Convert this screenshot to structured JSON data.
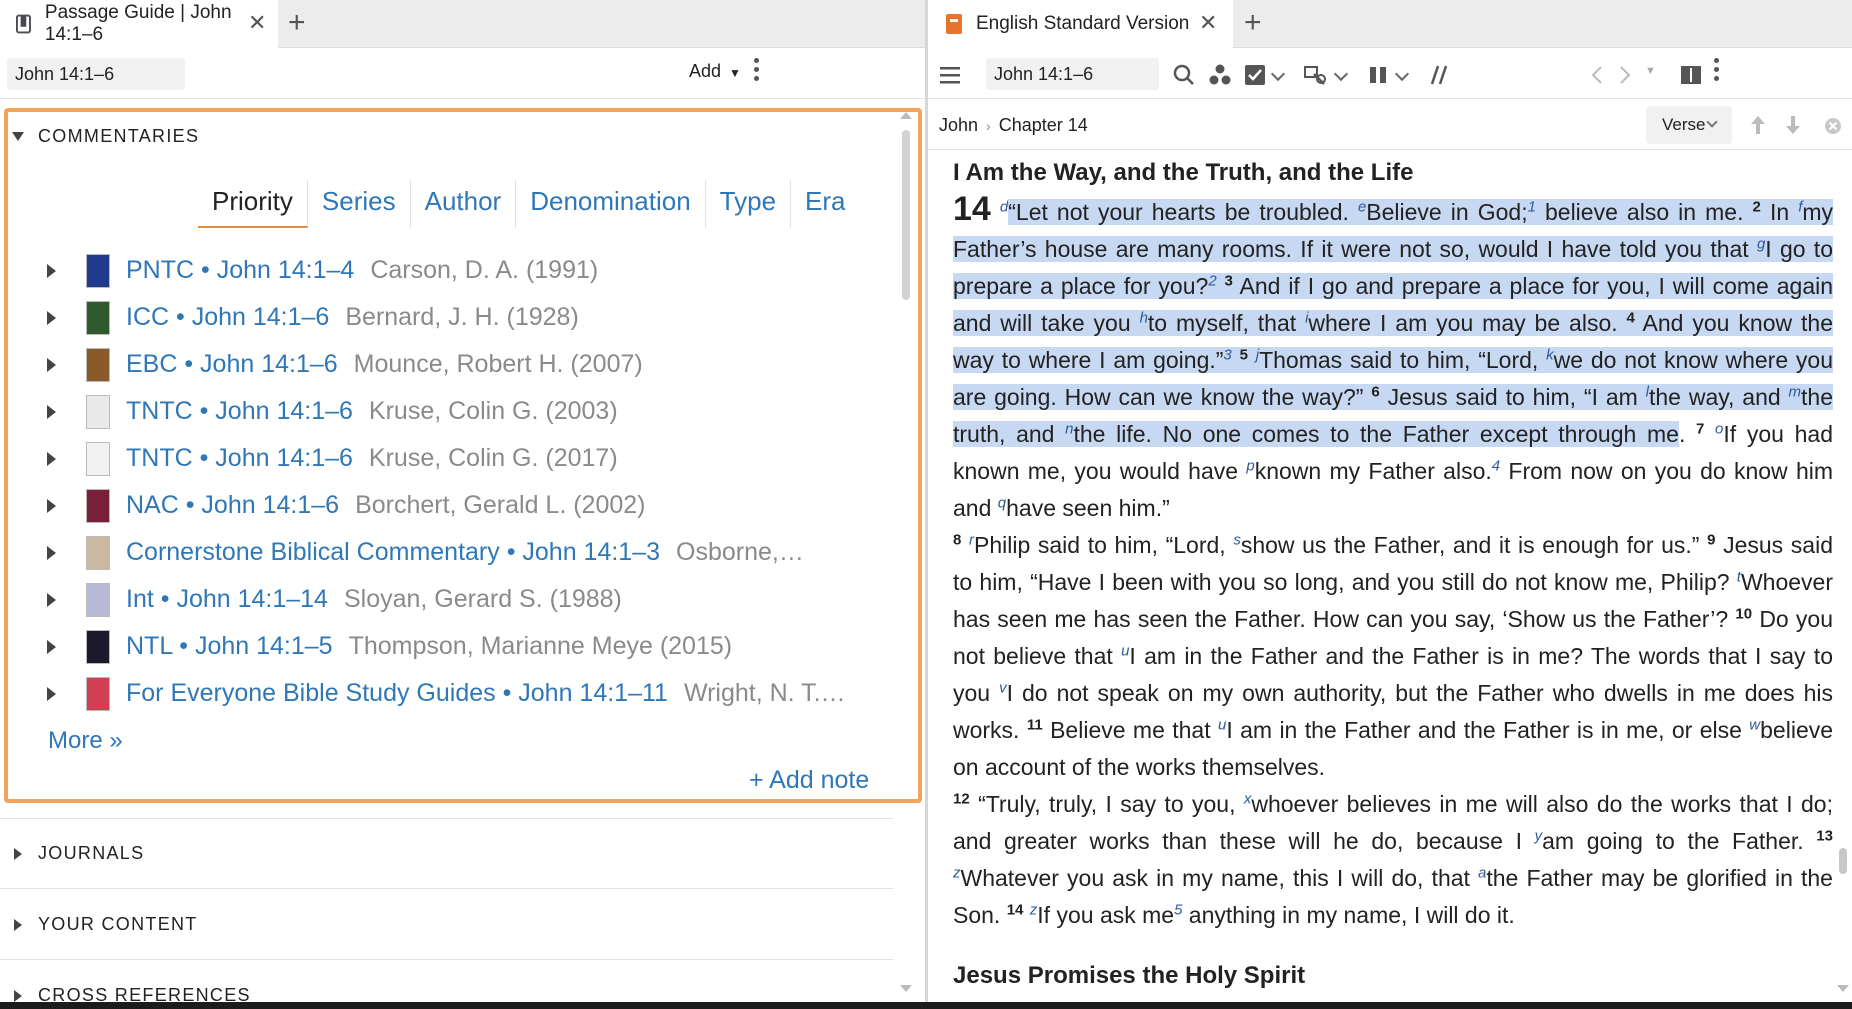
{
  "left": {
    "tab_title": "Passage Guide | John 14:1–6",
    "reference": "John 14:1–6",
    "add_label": "Add",
    "commentaries": {
      "heading": "COMMENTARIES",
      "sort_tabs": [
        "Priority",
        "Series",
        "Author",
        "Denomination",
        "Type",
        "Era"
      ],
      "items": [
        {
          "title": "PNTC • John 14:1–4",
          "author": "Carson, D. A. (1991)",
          "cover": "#1f3a8a"
        },
        {
          "title": "ICC • John 14:1–6",
          "author": "Bernard, J. H. (1928)",
          "cover": "#2f5a2b"
        },
        {
          "title": "EBC • John 14:1–6",
          "author": "Mounce, Robert H. (2007)",
          "cover": "#8a5a2b"
        },
        {
          "title": "TNTC • John 14:1–6",
          "author": "Kruse, Colin G. (2003)",
          "cover": "#e9e9e9"
        },
        {
          "title": "TNTC • John 14:1–6",
          "author": "Kruse, Colin G. (2017)",
          "cover": "#f2f2f2"
        },
        {
          "title": "NAC • John 14:1–6",
          "author": "Borchert, Gerald L. (2002)",
          "cover": "#7a1f3a"
        },
        {
          "title": "Cornerstone Biblical Commentary • John 14:1–3",
          "author": "Osborne,…",
          "cover": "#c9b9a0"
        },
        {
          "title": "Int • John 14:1–14",
          "author": "Sloyan, Gerard S. (1988)",
          "cover": "#b8b8d8"
        },
        {
          "title": "NTL • John 14:1–5",
          "author": "Thompson, Marianne Meye (2015)",
          "cover": "#1a1a2a"
        },
        {
          "title": "For Everyone Bible Study Guides • John 14:1–11",
          "author": "Wright, N. T.…",
          "cover": "#d04050"
        }
      ],
      "more_label": "More »",
      "add_note_label": "+ Add note"
    },
    "sections": [
      "JOURNALS",
      "YOUR CONTENT",
      "CROSS REFERENCES"
    ]
  },
  "right": {
    "tab_title": "English Standard Version",
    "reference": "John 14:1–6",
    "breadcrumb": [
      "John",
      "Chapter 14"
    ],
    "verse_label": "Verse",
    "pericope_1": "I Am the Way, and the Truth, and the Life",
    "chapter_number": "14",
    "pericope_2": "Jesus Promises the Holy Spirit",
    "text": {
      "v1a": "Let not your hearts be troubled. ",
      "v1b": "Believe in God;",
      "v1c": " believe also in me. ",
      "v2a": "In ",
      "v2b": "my Father’s house are many rooms. If it were not so, would I have told you that ",
      "v2c": "I go to prepare a place for you?",
      "v3a": "And if I go and prepare a place for you, I will come again and will take you ",
      "v3b": "to myself, that ",
      "v3c": "where I am you may be also. ",
      "v4": "And you know the way to where I am going.”",
      "v5a": "Thomas said to him, “Lord, ",
      "v5b": "we do not know where you are going. How can we know the way?” ",
      "v6a": "Jesus said to him, “I am ",
      "v6b": "the way, and ",
      "v6c": "the truth, and ",
      "v6d": "the life. No one comes to the Father except through me",
      "v6e": ". ",
      "v7a": "If you had known me, you would have ",
      "v7b": "known my Father also.",
      "v7c": " From now on you do know him and ",
      "v7d": "have seen him.”",
      "v8a": "Philip said to him, “Lord, ",
      "v8b": "show us the Father, and it is enough for us.” ",
      "v9a": "Jesus said to him, “Have I been with you so long, and you still do not know me, Philip? ",
      "v9b": "Whoever has seen me has seen the Father. How can you say, ‘Show us the Father’? ",
      "v10a": "Do you not believe that ",
      "v10b": "I am in the Father and the Father is in me? The words that I say to you ",
      "v10c": "I do not speak on my own authority, but the Father who dwells in me does his works. ",
      "v11a": "Believe me that ",
      "v11b": "I am in the Father and the Father is in me, or else ",
      "v11c": "believe on account of the works themselves.",
      "v12a": "“Truly, truly, I say to you, ",
      "v12b": "whoever believes in me will also do the works that I do; and greater works than these will he do, because I ",
      "v12c": "am going to the Father. ",
      "v13a": "Whatever you ask in my name, this I will do, that ",
      "v13b": "the Father may be glorified in the Son. ",
      "v14a": "If you ask me",
      "v14b": " anything in my name, I will do it."
    },
    "verse_numbers": [
      "2",
      "3",
      "4",
      "5",
      "6",
      "7",
      "8",
      "9",
      "10",
      "11",
      "12",
      "13",
      "14"
    ],
    "xrefs": [
      "d",
      "e",
      "f",
      "g",
      "h",
      "i",
      "j",
      "k",
      "l",
      "m",
      "n",
      "o",
      "p",
      "q",
      "r",
      "s",
      "t",
      "u",
      "v",
      "u",
      "w",
      "x",
      "y",
      "z",
      "a",
      "z"
    ],
    "footnotes": [
      "1",
      "2",
      "3",
      "4",
      "5"
    ]
  }
}
